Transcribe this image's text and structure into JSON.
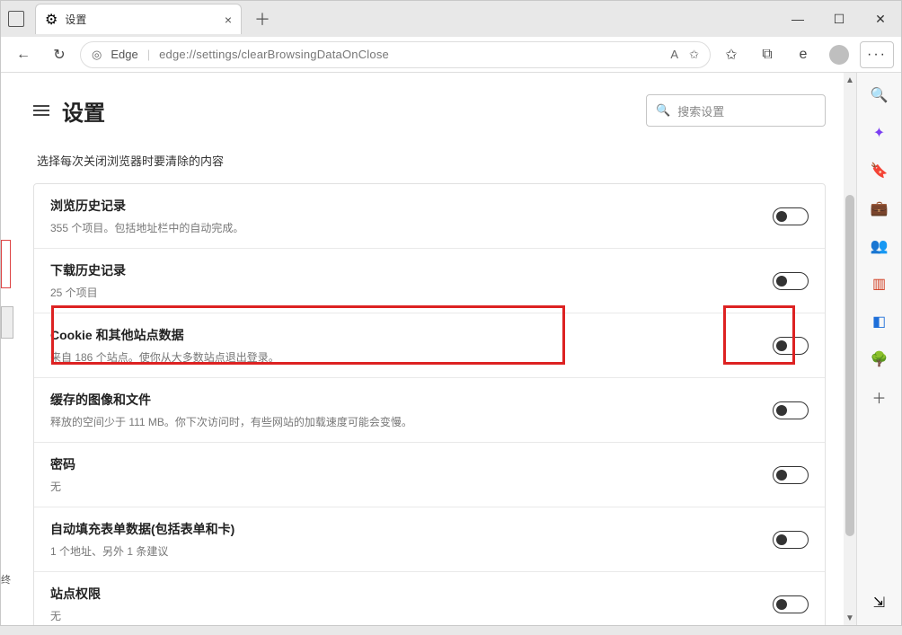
{
  "window": {
    "tab_title": "设置",
    "new_tab_glyph": "＋",
    "minimize": "—",
    "maximize": "☐",
    "close": "✕"
  },
  "toolbar": {
    "back_glyph": "←",
    "reload_glyph": "↻",
    "edge_label": "Edge",
    "url": "edge://settings/clearBrowsingDataOnClose",
    "star_glyph": "✩",
    "fav_glyph": "✩",
    "collections_glyph": "⧉",
    "ie_glyph": "e",
    "profile_color": "#bfbfbf",
    "more_glyph": "···"
  },
  "page": {
    "heading": "设置",
    "search_placeholder": "搜索设置",
    "subheading": "选择每次关闭浏览器时要清除的内容"
  },
  "items": [
    {
      "title": "浏览历史记录",
      "desc": "355 个项目。包括地址栏中的自动完成。",
      "on": false
    },
    {
      "title": "下载历史记录",
      "desc": "25 个项目",
      "on": false
    },
    {
      "title": "Cookie 和其他站点数据",
      "desc": "来自 186 个站点。使你从大多数站点退出登录。",
      "on": false,
      "highlighted": true
    },
    {
      "title": "缓存的图像和文件",
      "desc": "释放的空间少于 111 MB。你下次访问时，有些网站的加载速度可能会变慢。",
      "on": false
    },
    {
      "title": "密码",
      "desc": "无",
      "on": false
    },
    {
      "title": "自动填充表单数据(包括表单和卡)",
      "desc": "1 个地址、另外 1 条建议",
      "on": false
    },
    {
      "title": "站点权限",
      "desc": "无",
      "on": false
    }
  ],
  "sidebar_icons": [
    {
      "name": "search-icon",
      "glyph": "🔍",
      "color": "#0067c0"
    },
    {
      "name": "sparkle-icon",
      "glyph": "✦",
      "color": "#7b3ff2"
    },
    {
      "name": "tag-icon",
      "glyph": "🔖",
      "color": "#1e6fd9"
    },
    {
      "name": "briefcase-icon",
      "glyph": "💼",
      "color": "#c77b2e"
    },
    {
      "name": "people-icon",
      "glyph": "👥",
      "color": "#2e6fc7"
    },
    {
      "name": "office-icon",
      "glyph": "▥",
      "color": "#d13b1e"
    },
    {
      "name": "outlook-icon",
      "glyph": "◧",
      "color": "#1e6fd9"
    },
    {
      "name": "tree-icon",
      "glyph": "🌳",
      "color": "#2e9e3f"
    },
    {
      "name": "add-icon",
      "glyph": "＋",
      "color": "#555"
    }
  ],
  "partial_left": "终"
}
